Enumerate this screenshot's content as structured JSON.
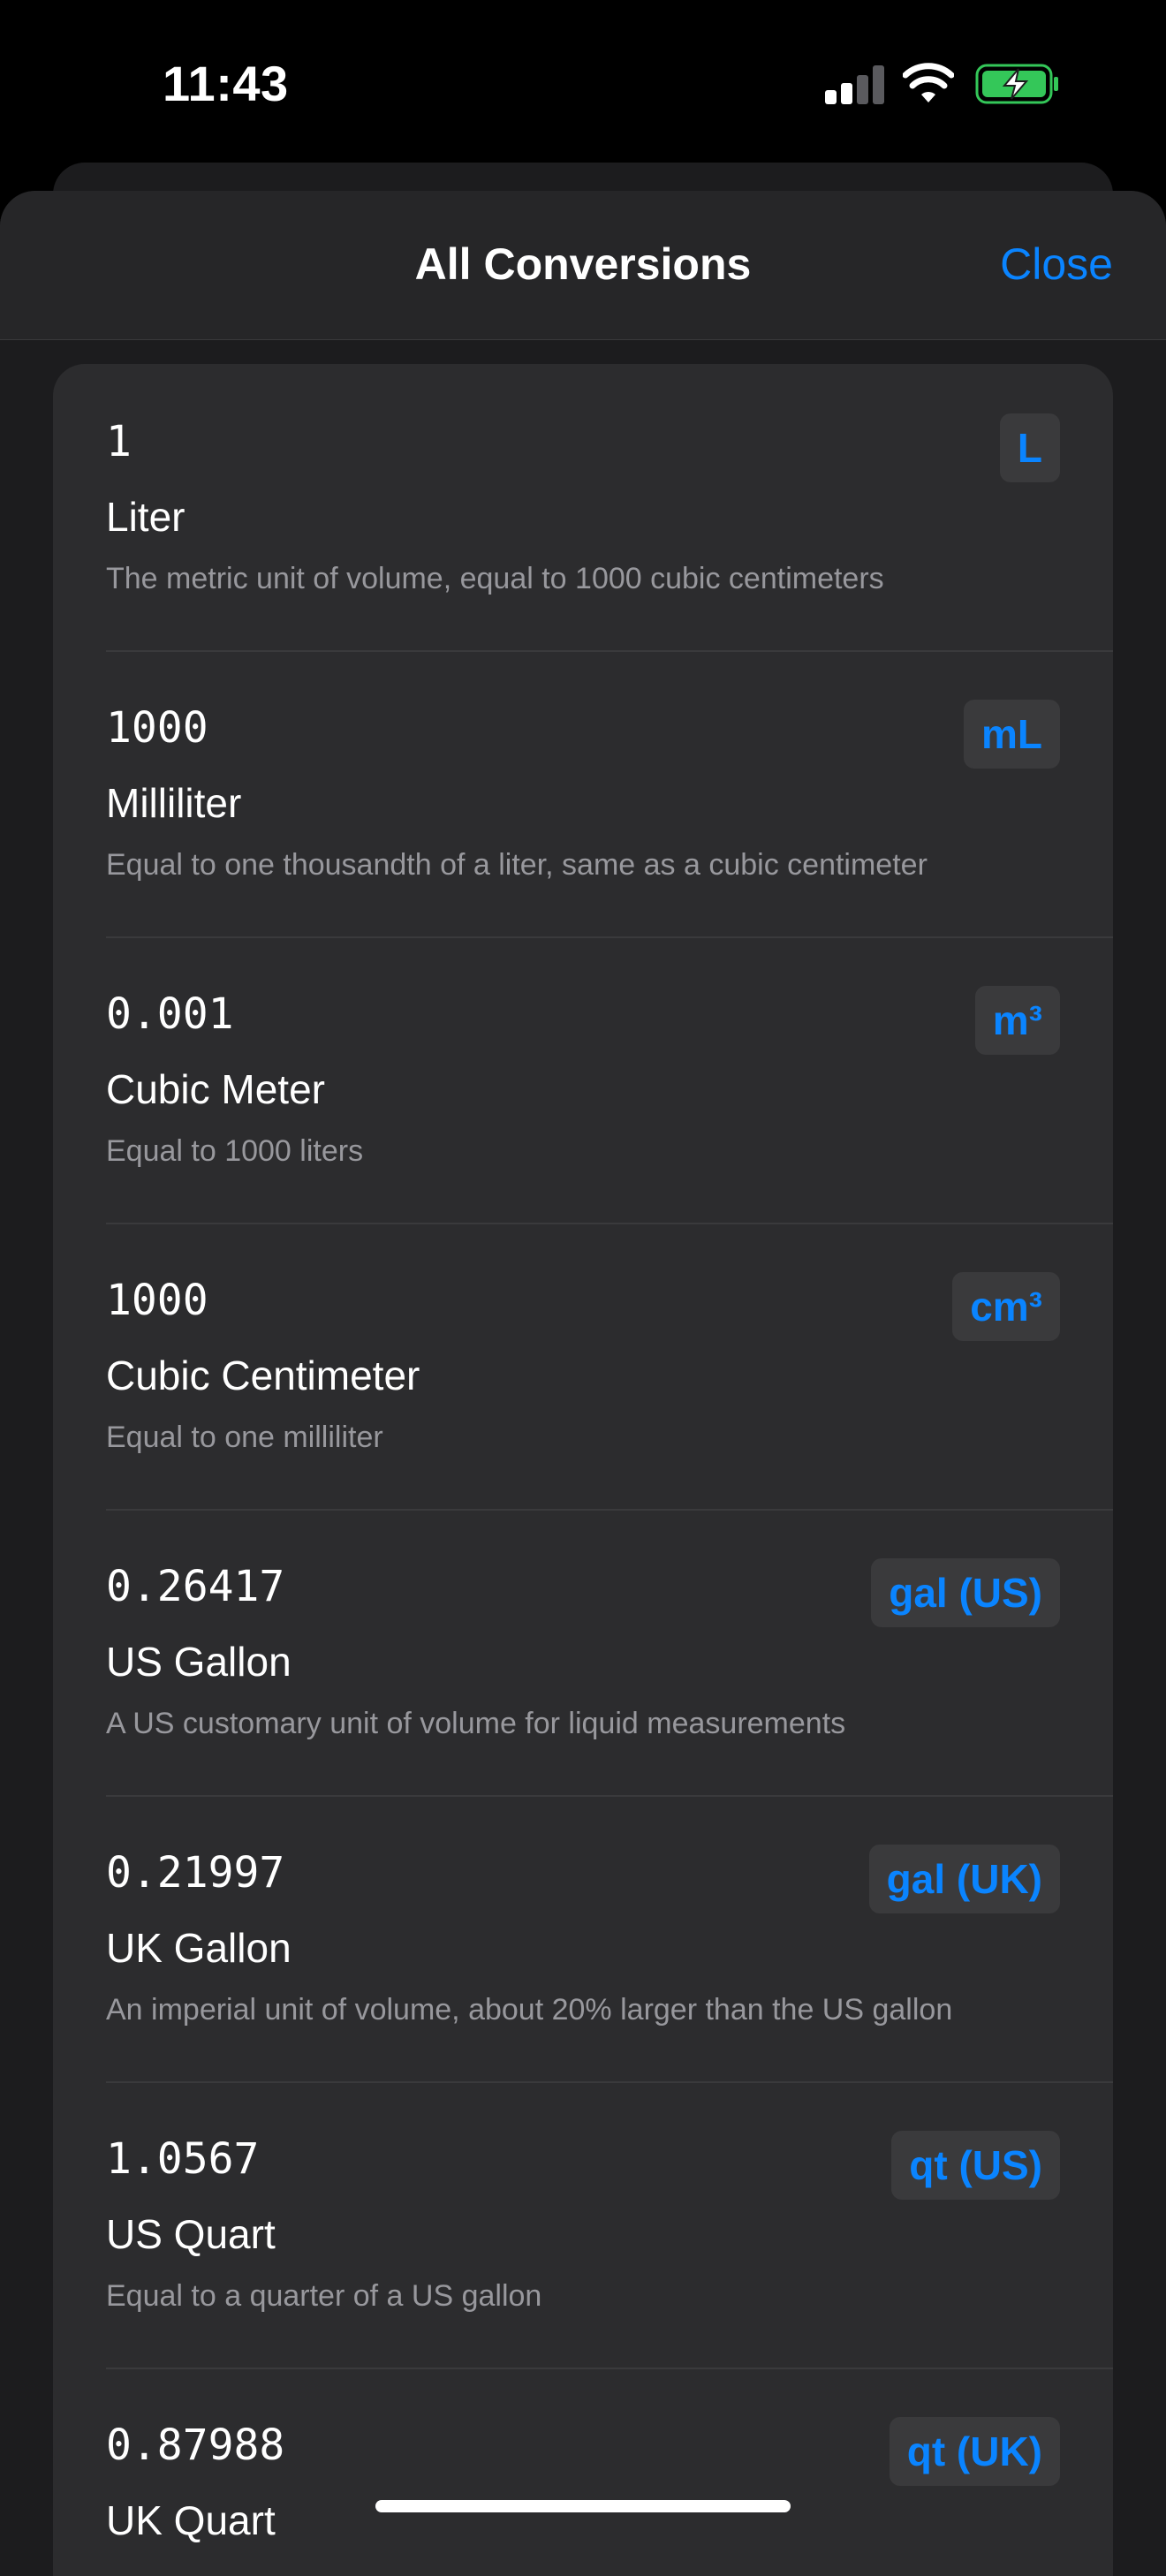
{
  "status_bar": {
    "time": "11:43"
  },
  "sheet": {
    "title": "All Conversions",
    "close_label": "Close"
  },
  "conversions": [
    {
      "value": "1",
      "name": "Liter",
      "symbol": "L",
      "description": "The metric unit of volume, equal to 1000 cubic centimeters"
    },
    {
      "value": "1000",
      "name": "Milliliter",
      "symbol": "mL",
      "description": "Equal to one thousandth of a liter, same as a cubic centimeter"
    },
    {
      "value": "0.001",
      "name": "Cubic Meter",
      "symbol": "m³",
      "description": "Equal to 1000 liters"
    },
    {
      "value": "1000",
      "name": "Cubic Centimeter",
      "symbol": "cm³",
      "description": "Equal to one milliliter"
    },
    {
      "value": "0.26417",
      "name": "US Gallon",
      "symbol": "gal (US)",
      "description": "A US customary unit of volume for liquid measurements"
    },
    {
      "value": "0.21997",
      "name": "UK Gallon",
      "symbol": "gal (UK)",
      "description": "An imperial unit of volume, about 20% larger than the US gallon"
    },
    {
      "value": "1.0567",
      "name": "US Quart",
      "symbol": "qt (US)",
      "description": "Equal to a quarter of a US gallon"
    },
    {
      "value": "0.87988",
      "name": "UK Quart",
      "symbol": "qt (UK)",
      "description": ""
    }
  ],
  "colors": {
    "accent": "#0a84ff",
    "sheet_bg": "#1c1c1e",
    "card_bg": "#2c2c2e",
    "secondary_text": "#98989d",
    "battery_green": "#34c759"
  }
}
